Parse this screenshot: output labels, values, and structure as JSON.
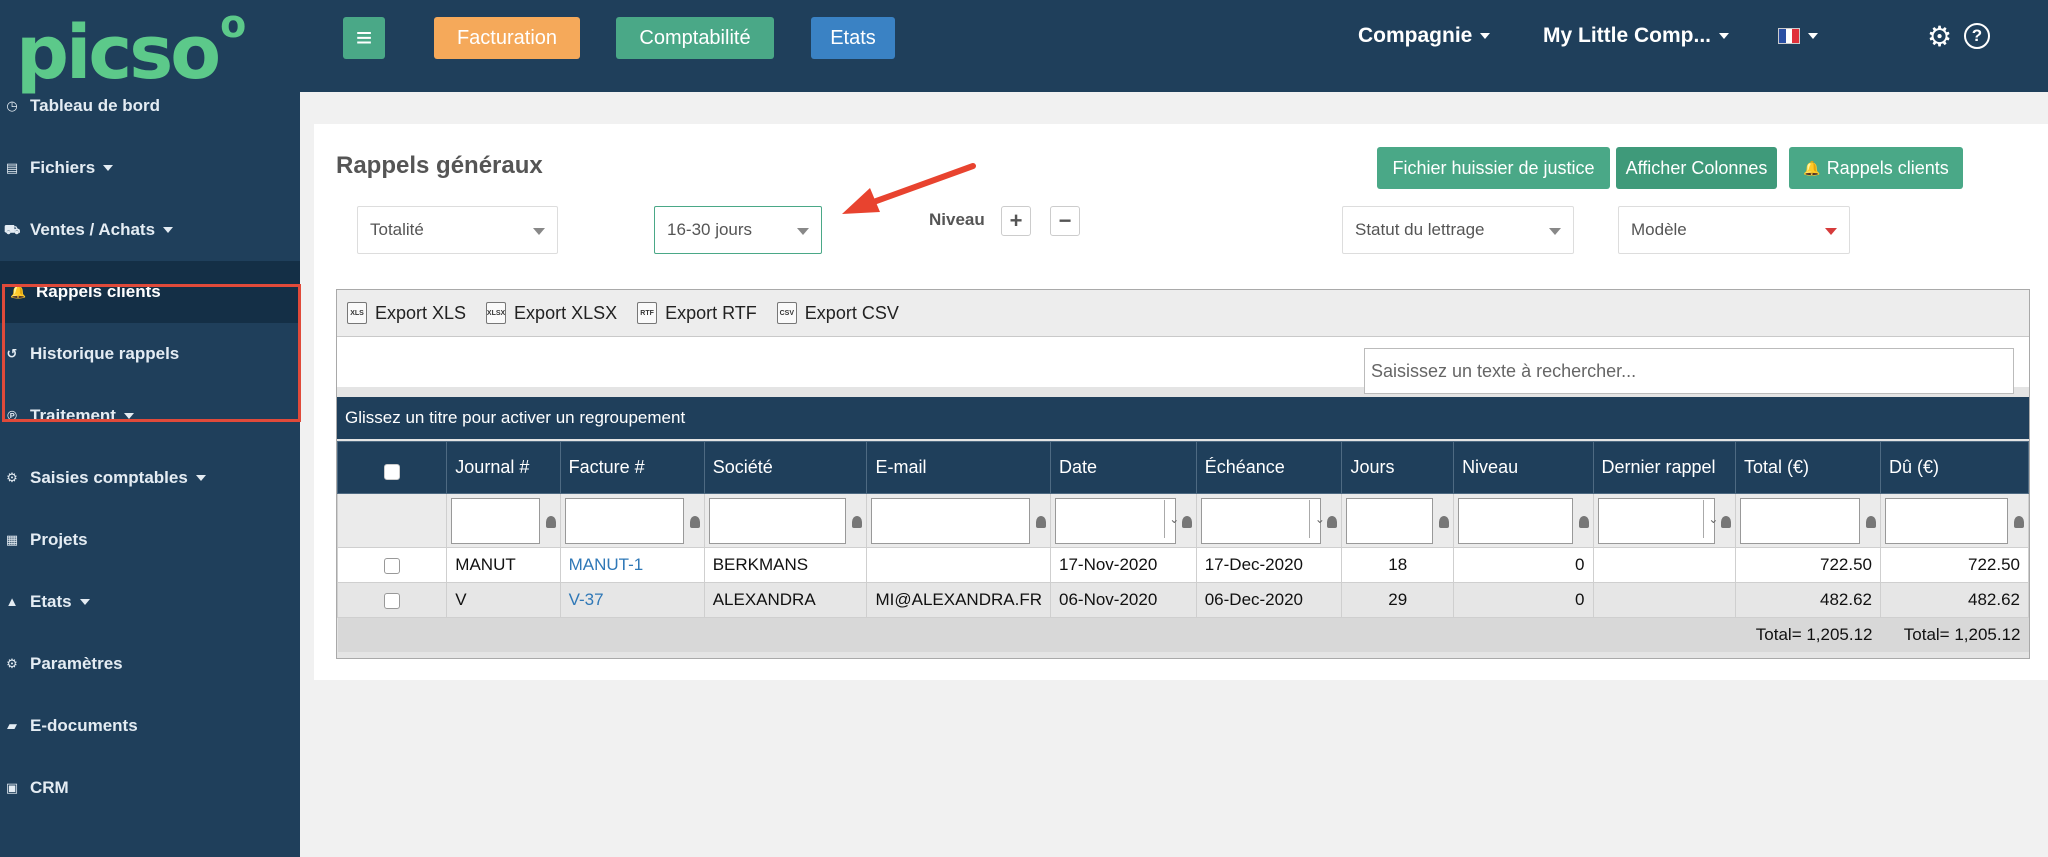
{
  "logo": {
    "text": "picso",
    "superscript": "o",
    "color": "#5cc98a"
  },
  "sidebar": {
    "items": [
      {
        "label": "Tableau de bord",
        "icon": "dashboard-icon",
        "glyph": "◷",
        "caret": false
      },
      {
        "label": "Fichiers",
        "icon": "file-icon",
        "glyph": "▤",
        "caret": true
      },
      {
        "label": "Ventes / Achats",
        "icon": "cart-icon",
        "glyph": "⛟",
        "caret": true
      },
      {
        "label": "Rappels clients",
        "icon": "bell-icon",
        "glyph": "🔔",
        "caret": false,
        "active": true
      },
      {
        "label": "Historique rappels",
        "icon": "history-icon",
        "glyph": "↺",
        "caret": false
      },
      {
        "label": "Traitement",
        "icon": "processing-icon",
        "glyph": "℗",
        "caret": true
      },
      {
        "label": "Saisies comptables",
        "icon": "gears-icon",
        "glyph": "⚙",
        "caret": true
      },
      {
        "label": "Projets",
        "icon": "projects-icon",
        "glyph": "▦",
        "caret": false
      },
      {
        "label": "Etats",
        "icon": "chart-icon",
        "glyph": "▲",
        "caret": true
      },
      {
        "label": "Paramètres",
        "icon": "settings-icon",
        "glyph": "⚙",
        "caret": false
      },
      {
        "label": "E-documents",
        "icon": "folder-icon",
        "glyph": "▰",
        "caret": false
      },
      {
        "label": "CRM",
        "icon": "contact-card-icon",
        "glyph": "▣",
        "caret": false
      }
    ]
  },
  "topbar": {
    "menu_glyph": "≡",
    "facturation": "Facturation",
    "comptabilite": "Comptabilité",
    "etats": "Etats",
    "compagnie": "Compagnie",
    "company_name": "My Little Comp...",
    "settings_glyph": "⚙",
    "help_glyph": "?",
    "colors": {
      "facturation": "#f5a95a",
      "comptabilite": "#4aa887",
      "etats": "#3a82c4",
      "menu": "#4aa887"
    }
  },
  "page": {
    "title": "Rappels généraux",
    "buttons": {
      "huissier": "Fichier huissier de justice",
      "colonnes": "Afficher Colonnes",
      "rappels": "Rappels clients",
      "bell_glyph": "🔔"
    },
    "filters": {
      "totalite": "Totalité",
      "period": "16-30 jours",
      "niveau_label": "Niveau",
      "plus": "+",
      "minus": "−",
      "lettrage": "Statut du lettrage",
      "modele": "Modèle"
    }
  },
  "grid": {
    "exports": [
      {
        "label": "Export XLS",
        "tag": "XLS"
      },
      {
        "label": "Export XLSX",
        "tag": "XLSX"
      },
      {
        "label": "Export RTF",
        "tag": "RTF"
      },
      {
        "label": "Export CSV",
        "tag": "CSV"
      }
    ],
    "search_placeholder": "Saisissez un texte à rechercher...",
    "group_hint": "Glissez un titre pour activer un regroupement",
    "columns": [
      "",
      "Journal #",
      "Facture #",
      "Société",
      "E-mail",
      "Date",
      "Échéance",
      "Jours",
      "Niveau",
      "Dernier rappel",
      "Total (€)",
      "Dû  (€)"
    ],
    "rows": [
      {
        "journal": "MANUT",
        "facture": "MANUT-1",
        "societe": "BERKMANS",
        "email": "",
        "date": "17-Nov-2020",
        "echeance": "17-Dec-2020",
        "jours": "18",
        "niveau": "0",
        "dernier": "",
        "total": "722.50",
        "du": "722.50"
      },
      {
        "journal": "V",
        "facture": "V-37",
        "societe": "ALEXANDRA",
        "email": "MI@ALEXANDRA.FR",
        "date": "06-Nov-2020",
        "echeance": "06-Dec-2020",
        "jours": "29",
        "niveau": "0",
        "dernier": "",
        "total": "482.62",
        "du": "482.62"
      }
    ],
    "totals": {
      "total": "Total= 1,205.12",
      "du": "Total= 1,205.12"
    }
  }
}
